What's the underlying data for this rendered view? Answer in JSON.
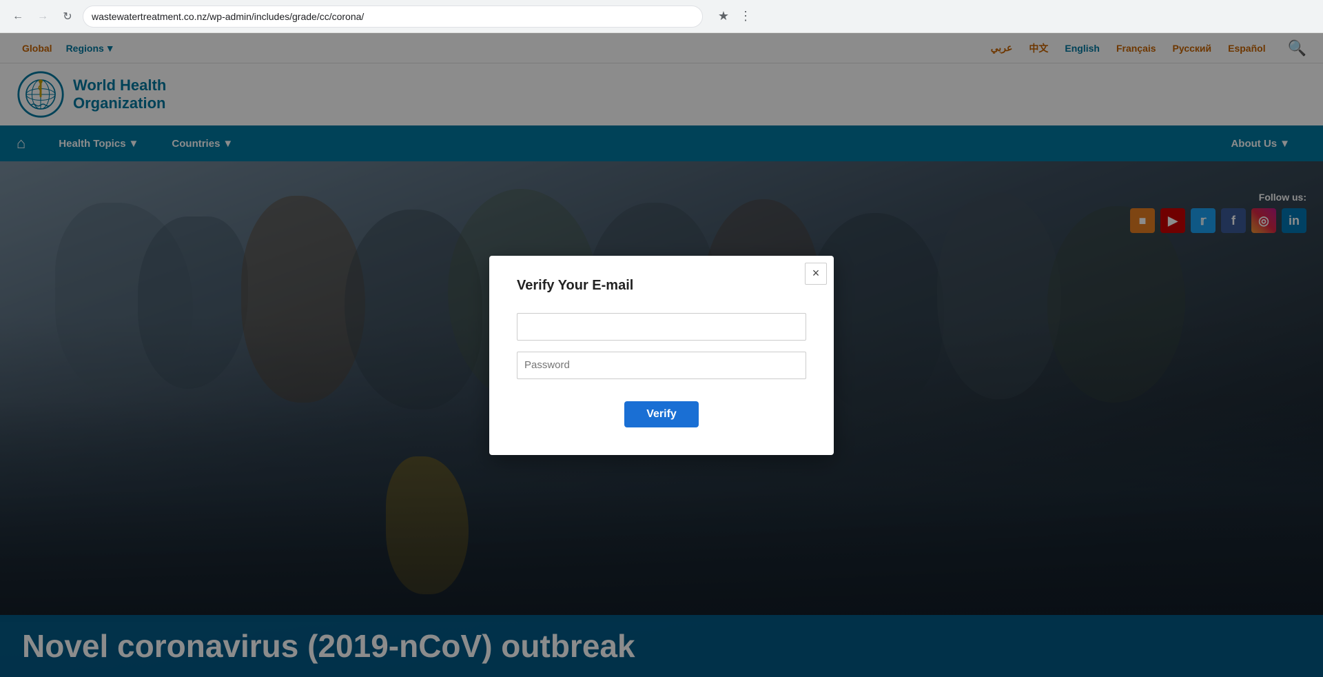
{
  "browser": {
    "url": "wastewatertreatment.co.nz/wp-admin/includes/grade/cc/corona/",
    "back_disabled": false,
    "forward_disabled": true
  },
  "topbar": {
    "global_label": "Global",
    "regions_label": "Regions",
    "lang_ar": "عربي",
    "lang_zh": "中文",
    "lang_en": "English",
    "lang_fr": "Français",
    "lang_ru": "Русский",
    "lang_es": "Español"
  },
  "header": {
    "org_line1": "World Health",
    "org_line2": "Organization",
    "org_full": "World Health Organization"
  },
  "nav": {
    "health_topics": "Health Topics",
    "countries": "Countries",
    "about_us": "About Us"
  },
  "follow": {
    "label": "Follow us:"
  },
  "hero": {
    "caption": "Novel coronavirus (2019-nCoV) outbreak"
  },
  "modal": {
    "title": "Verify Your E-mail",
    "email_placeholder": "",
    "password_placeholder": "Password",
    "verify_label": "Verify",
    "close_label": "×"
  }
}
